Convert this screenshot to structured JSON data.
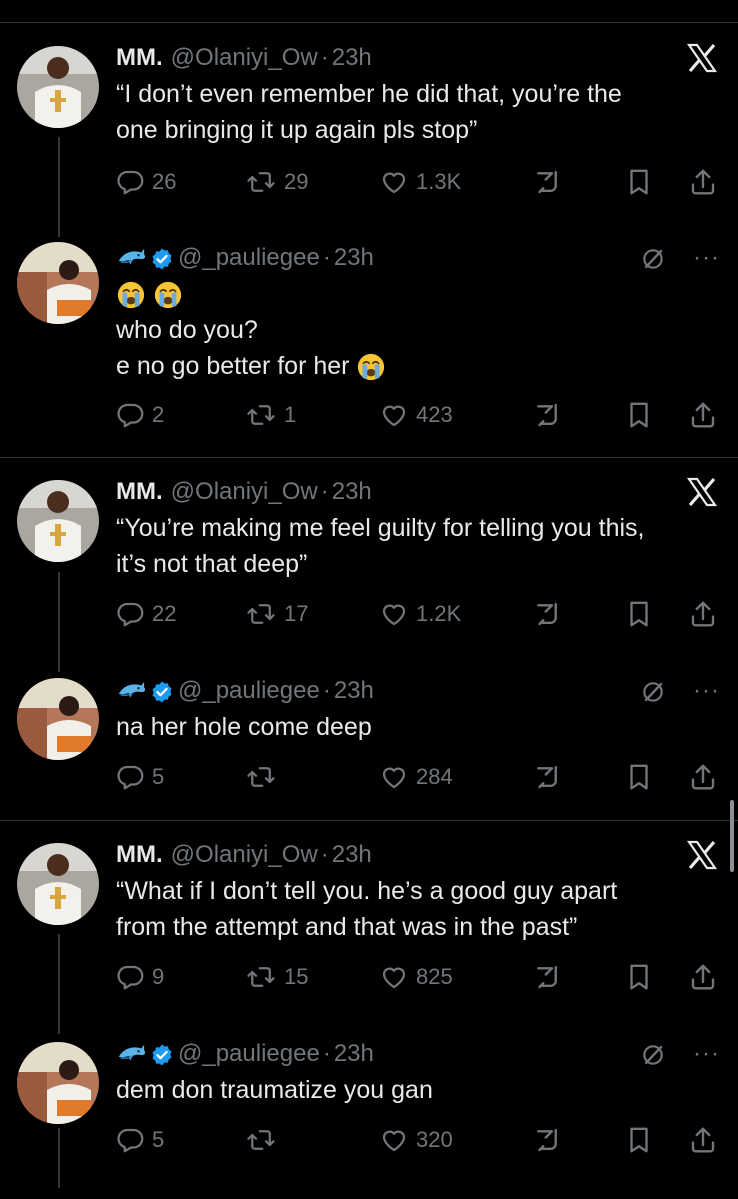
{
  "tweets": [
    {
      "name": "MM.",
      "handle": "@Olaniyi_Ow",
      "dot": "·",
      "time": "23h",
      "text": [
        "“I don’t even remember he did that, you’re the",
        "one bringing it up again pls stop”"
      ],
      "replies": "26",
      "reposts": "29",
      "likes": "1.3K"
    },
    {
      "name": "",
      "handle": "@_pauliegee",
      "dot": "·",
      "time": "23h",
      "text": [
        "",
        "who do you?",
        "e no go better for her"
      ],
      "replies": "2",
      "reposts": "1",
      "likes": "423"
    },
    {
      "name": "MM.",
      "handle": "@Olaniyi_Ow",
      "dot": "·",
      "time": "23h",
      "text": [
        "“You’re making me feel guilty for telling you this,",
        "it’s not that deep”"
      ],
      "replies": "22",
      "reposts": "17",
      "likes": "1.2K"
    },
    {
      "name": "",
      "handle": "@_pauliegee",
      "dot": "·",
      "time": "23h",
      "text": [
        "na her hole come deep"
      ],
      "replies": "5",
      "reposts": "",
      "likes": "284"
    },
    {
      "name": "MM.",
      "handle": "@Olaniyi_Ow",
      "dot": "·",
      "time": "23h",
      "text": [
        "“What if I don’t tell you. he’s a good guy apart",
        "from the attempt and that was in the past”"
      ],
      "replies": "9",
      "reposts": "15",
      "likes": "825"
    },
    {
      "name": "",
      "handle": "@_pauliegee",
      "dot": "·",
      "time": "23h",
      "text": [
        "dem don traumatize you gan"
      ],
      "replies": "5",
      "reposts": "",
      "likes": "320"
    }
  ],
  "more_label": "···",
  "icons": {
    "reply": "reply-icon",
    "repost": "repost-icon",
    "like": "heart-icon",
    "stats": "analytics-icon",
    "bookmark": "bookmark-icon",
    "share": "share-icon",
    "x": "x-logo-icon",
    "grok": "grok-icon",
    "verified": "verified-badge-icon",
    "dolphin": "dolphin-icon",
    "crying": "crying-emoji-icon"
  },
  "colors": {
    "background": "#000000",
    "text": "#e7e9ea",
    "muted": "#71767b",
    "verified": "#1d9bf0",
    "divider": "#2f3336"
  }
}
